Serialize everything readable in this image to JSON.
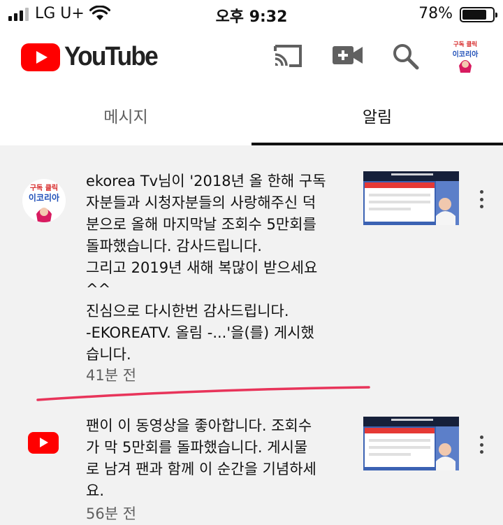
{
  "status_bar": {
    "carrier": "LG U+",
    "time": "오후 9:32",
    "battery_percent": "78%",
    "battery_level": 0.78,
    "signal_bars": 3
  },
  "app_bar": {
    "logo_text": "YouTube",
    "brand_color": "#ff0000",
    "icons": [
      "cast-icon",
      "video-camera-add-icon",
      "search-icon",
      "account-avatar"
    ],
    "avatar_badge": {
      "top": "구독 클릭",
      "bottom": "이코리아"
    }
  },
  "tabs": [
    {
      "label": "메시지",
      "active": false
    },
    {
      "label": "알림",
      "active": true
    }
  ],
  "notifications": [
    {
      "text": "ekorea Tv님이 '2018년 올 한해 구독\n자분들과 시청자분들의 사랑해주신 덕\n분으로 올해 마지막날 조회수 5만회를\n돌파했습니다. 감사드립니다.\n그리고 2019년 새해 복많이 받으세요\n^^\n진심으로 다시한번 감사드립니다.\n-EKOREATV. 올림 -...'을(를) 게시했\n습니다.",
      "time": "41분 전",
      "avatar": "channel-avatar",
      "has_menu": true
    },
    {
      "text": "팬이 이 동영상을 좋아합니다. 조회수\n가 막 5만회를 돌파했습니다. 게시물\n로 남겨 팬과 함께 이 순간을 기념하세\n요.",
      "time": "56분 전",
      "avatar": "youtube-icon",
      "has_menu": true
    }
  ],
  "colors": {
    "background": "#f2f2f2",
    "annotation_line": "#e8345a",
    "secondary_text": "#606060"
  }
}
